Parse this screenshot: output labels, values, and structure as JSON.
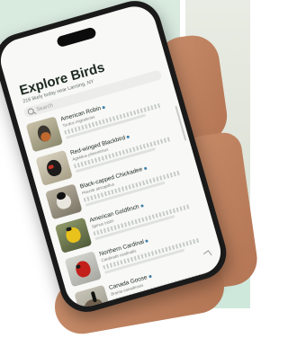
{
  "app": {
    "title": "Explore Birds",
    "subtitle": "216 likely today near Lansing, NY"
  },
  "search": {
    "placeholder": "Search"
  },
  "birds": [
    {
      "name": "American Robin",
      "scientific": "Turdus migratorius",
      "icon": "robin"
    },
    {
      "name": "Red-winged Blackbird",
      "scientific": "Agelaius phoeniceus",
      "icon": "blackbird"
    },
    {
      "name": "Black-capped Chickadee",
      "scientific": "Poecile atricapillus",
      "icon": "chickadee"
    },
    {
      "name": "American Goldfinch",
      "scientific": "Spinus tristis",
      "icon": "goldfinch"
    },
    {
      "name": "Northern Cardinal",
      "scientific": "Cardinalis cardinalis",
      "icon": "cardinal"
    },
    {
      "name": "Canada Goose",
      "scientific": "Branta canadensis",
      "icon": "goose"
    }
  ],
  "colors": {
    "verified_dot": "#3d7fa8",
    "background": "#d9eadf"
  }
}
